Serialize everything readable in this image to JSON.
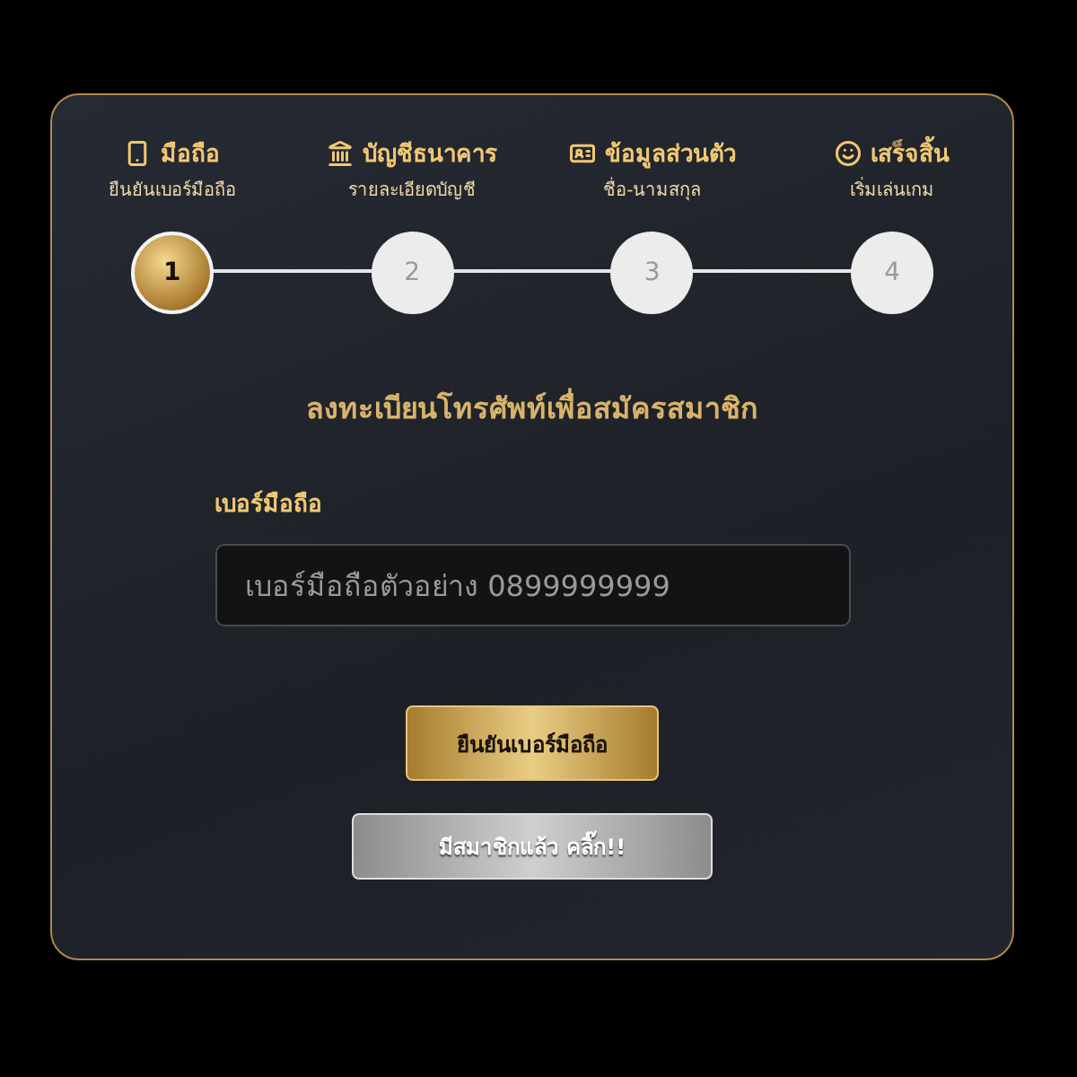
{
  "steps": [
    {
      "title": "มือถือ",
      "subtitle": "ยืนยันเบอร์มือถือ",
      "number": "1",
      "selected": true
    },
    {
      "title": "บัญชีธนาคาร",
      "subtitle": "รายละเอียดบัญชี",
      "number": "2",
      "selected": false
    },
    {
      "title": "ข้อมูลส่วนตัว",
      "subtitle": "ชื่อ-นามสกุล",
      "number": "3",
      "selected": false
    },
    {
      "title": "เสร็จสิ้น",
      "subtitle": "เริ่มเล่นเกม",
      "number": "4",
      "selected": false
    }
  ],
  "heading": "ลงทะเบียนโทรศัพท์เพื่อสมัครสมาชิก",
  "phone_field": {
    "label": "เบอร์มือถือ",
    "placeholder": "เบอร์มือถือตัวอย่าง 0899999999"
  },
  "buttons": [
    {
      "kind": "primary",
      "label": "ยืนยันเบอร์มือถือ"
    },
    {
      "kind": "secondary",
      "label": "มีสมาชิกแล้ว คลิ๊ก!!"
    }
  ]
}
